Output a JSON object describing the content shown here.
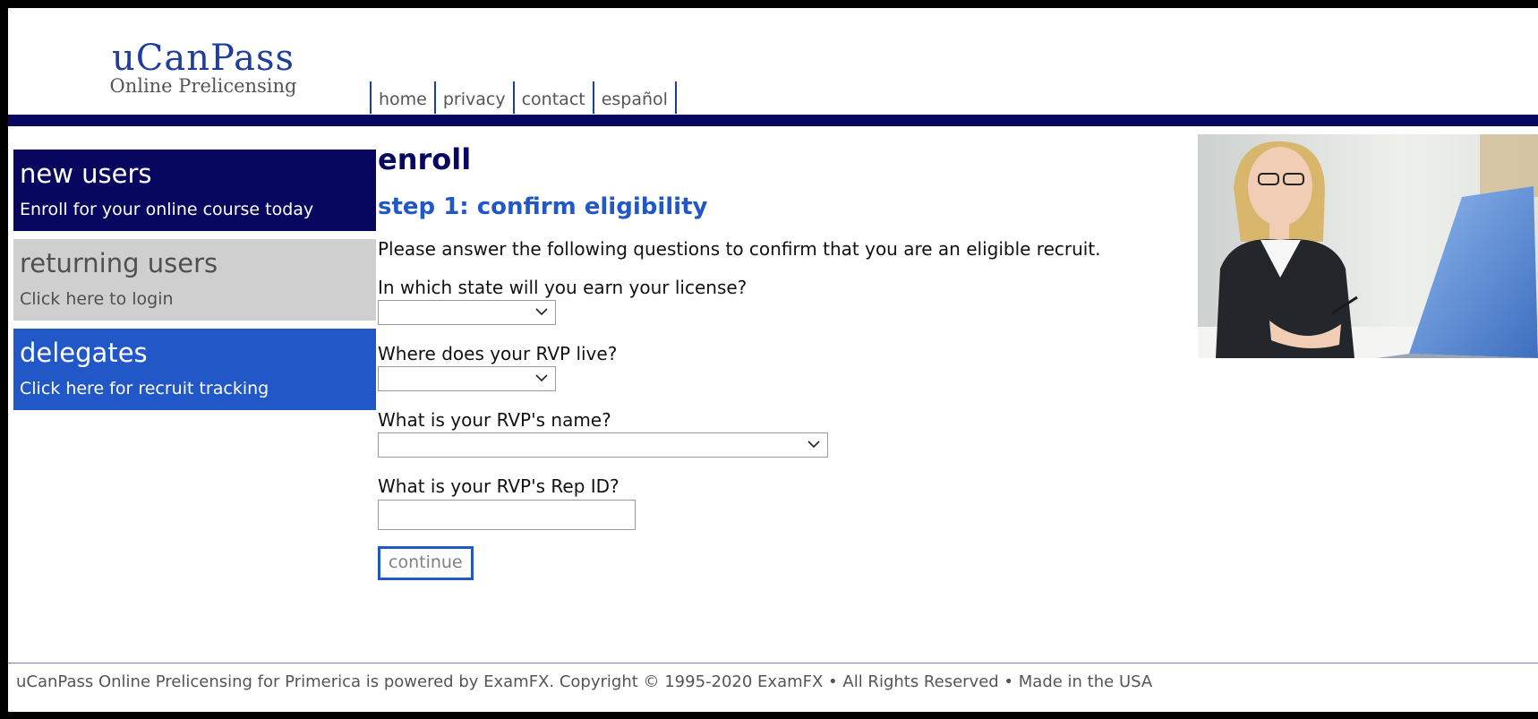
{
  "brand": {
    "name": "uCanPass",
    "tagline": "Online Prelicensing"
  },
  "topnav": {
    "items": [
      "home",
      "privacy",
      "contact",
      "español"
    ]
  },
  "sidebar": {
    "new_users": {
      "title": "new users",
      "subtitle": "Enroll for your online course today"
    },
    "returning_users": {
      "title": "returning users",
      "subtitle": "Click here to login"
    },
    "delegates": {
      "title": "delegates",
      "subtitle": "Click here for recruit tracking"
    }
  },
  "main": {
    "title": "enroll",
    "step": "step 1: confirm eligibility",
    "intro": "Please answer the following questions to confirm that you are an eligible recruit.",
    "q_state": "In which state will you earn your license?",
    "q_rvp_live": "Where does your RVP live?",
    "q_rvp_name": "What is your RVP's name?",
    "q_rvp_id": "What is your RVP's Rep ID?",
    "state_value": "",
    "rvp_live_value": "",
    "rvp_name_value": "",
    "rep_id_value": "",
    "continue_label": "continue"
  },
  "footer": {
    "text": "uCanPass Online Prelicensing for Primerica is powered by ExamFX. Copyright © 1995-2020 ExamFX • All Rights Reserved • Made in the USA"
  },
  "colors": {
    "navy": "#070760",
    "blue": "#2157c7",
    "gray": "#cfcfcf"
  }
}
